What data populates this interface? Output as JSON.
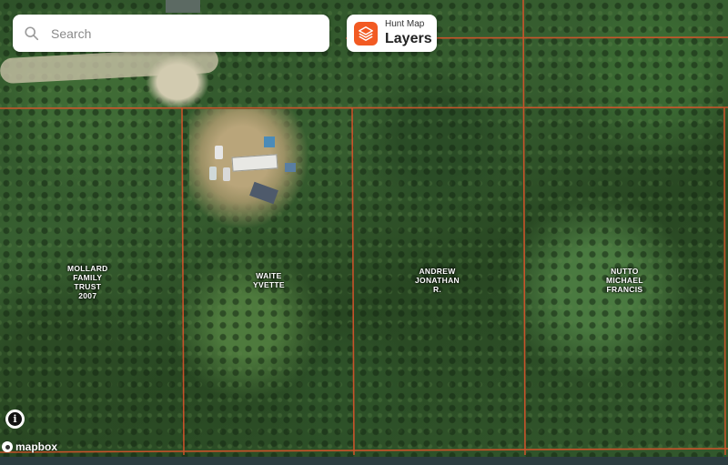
{
  "search": {
    "placeholder": "Search"
  },
  "layers": {
    "subtitle": "Hunt Map",
    "title": "Layers",
    "accent": "#f25a22"
  },
  "parcels": [
    {
      "id": "mollard",
      "lines": [
        "MOLLARD",
        "FAMILY",
        "TRUST",
        "2007"
      ]
    },
    {
      "id": "waite",
      "lines": [
        "WAITE",
        "YVETTE"
      ]
    },
    {
      "id": "andrew",
      "lines": [
        "ANDREW",
        "JONATHAN",
        "R."
      ]
    },
    {
      "id": "nutto",
      "lines": [
        "NUTTO",
        "MICHAEL",
        "FRANCIS"
      ]
    }
  ],
  "attribution": {
    "brand": "mapbox",
    "info_icon": "info-icon"
  },
  "colors": {
    "parcel_line": "#d9532b",
    "bottom_bar": "#2c3d40"
  }
}
